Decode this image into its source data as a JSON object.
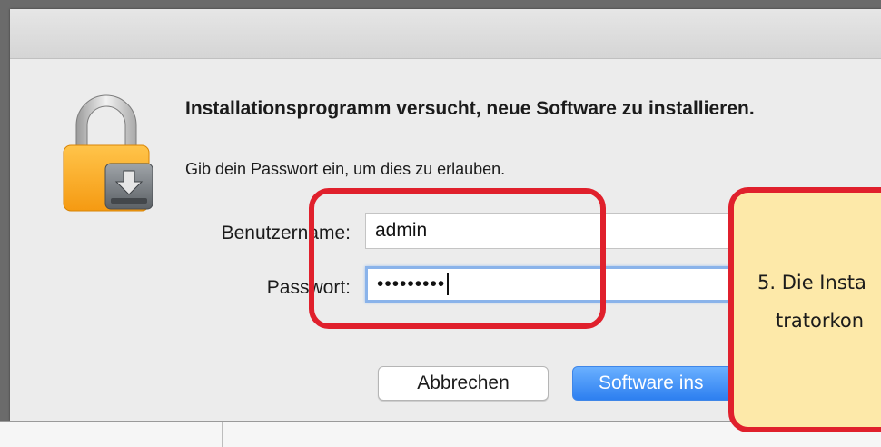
{
  "dialog": {
    "heading": "Installationsprogramm versucht, neue Software zu installieren.",
    "subtext": "Gib dein Passwort ein, um dies zu erlauben.",
    "username_label": "Benutzername:",
    "username_value": "admin",
    "password_label": "Passwort:",
    "password_value": "•••••••••",
    "cancel_label": "Abbrechen",
    "install_label": "Software ins",
    "icon": "lock-icon"
  },
  "annotation": {
    "line1": "5. Die Insta",
    "line2": "tratorkon"
  },
  "colors": {
    "highlight": "#e0202c",
    "callout_bg": "#fde9a9",
    "primary_button": "#2d7ff0"
  }
}
